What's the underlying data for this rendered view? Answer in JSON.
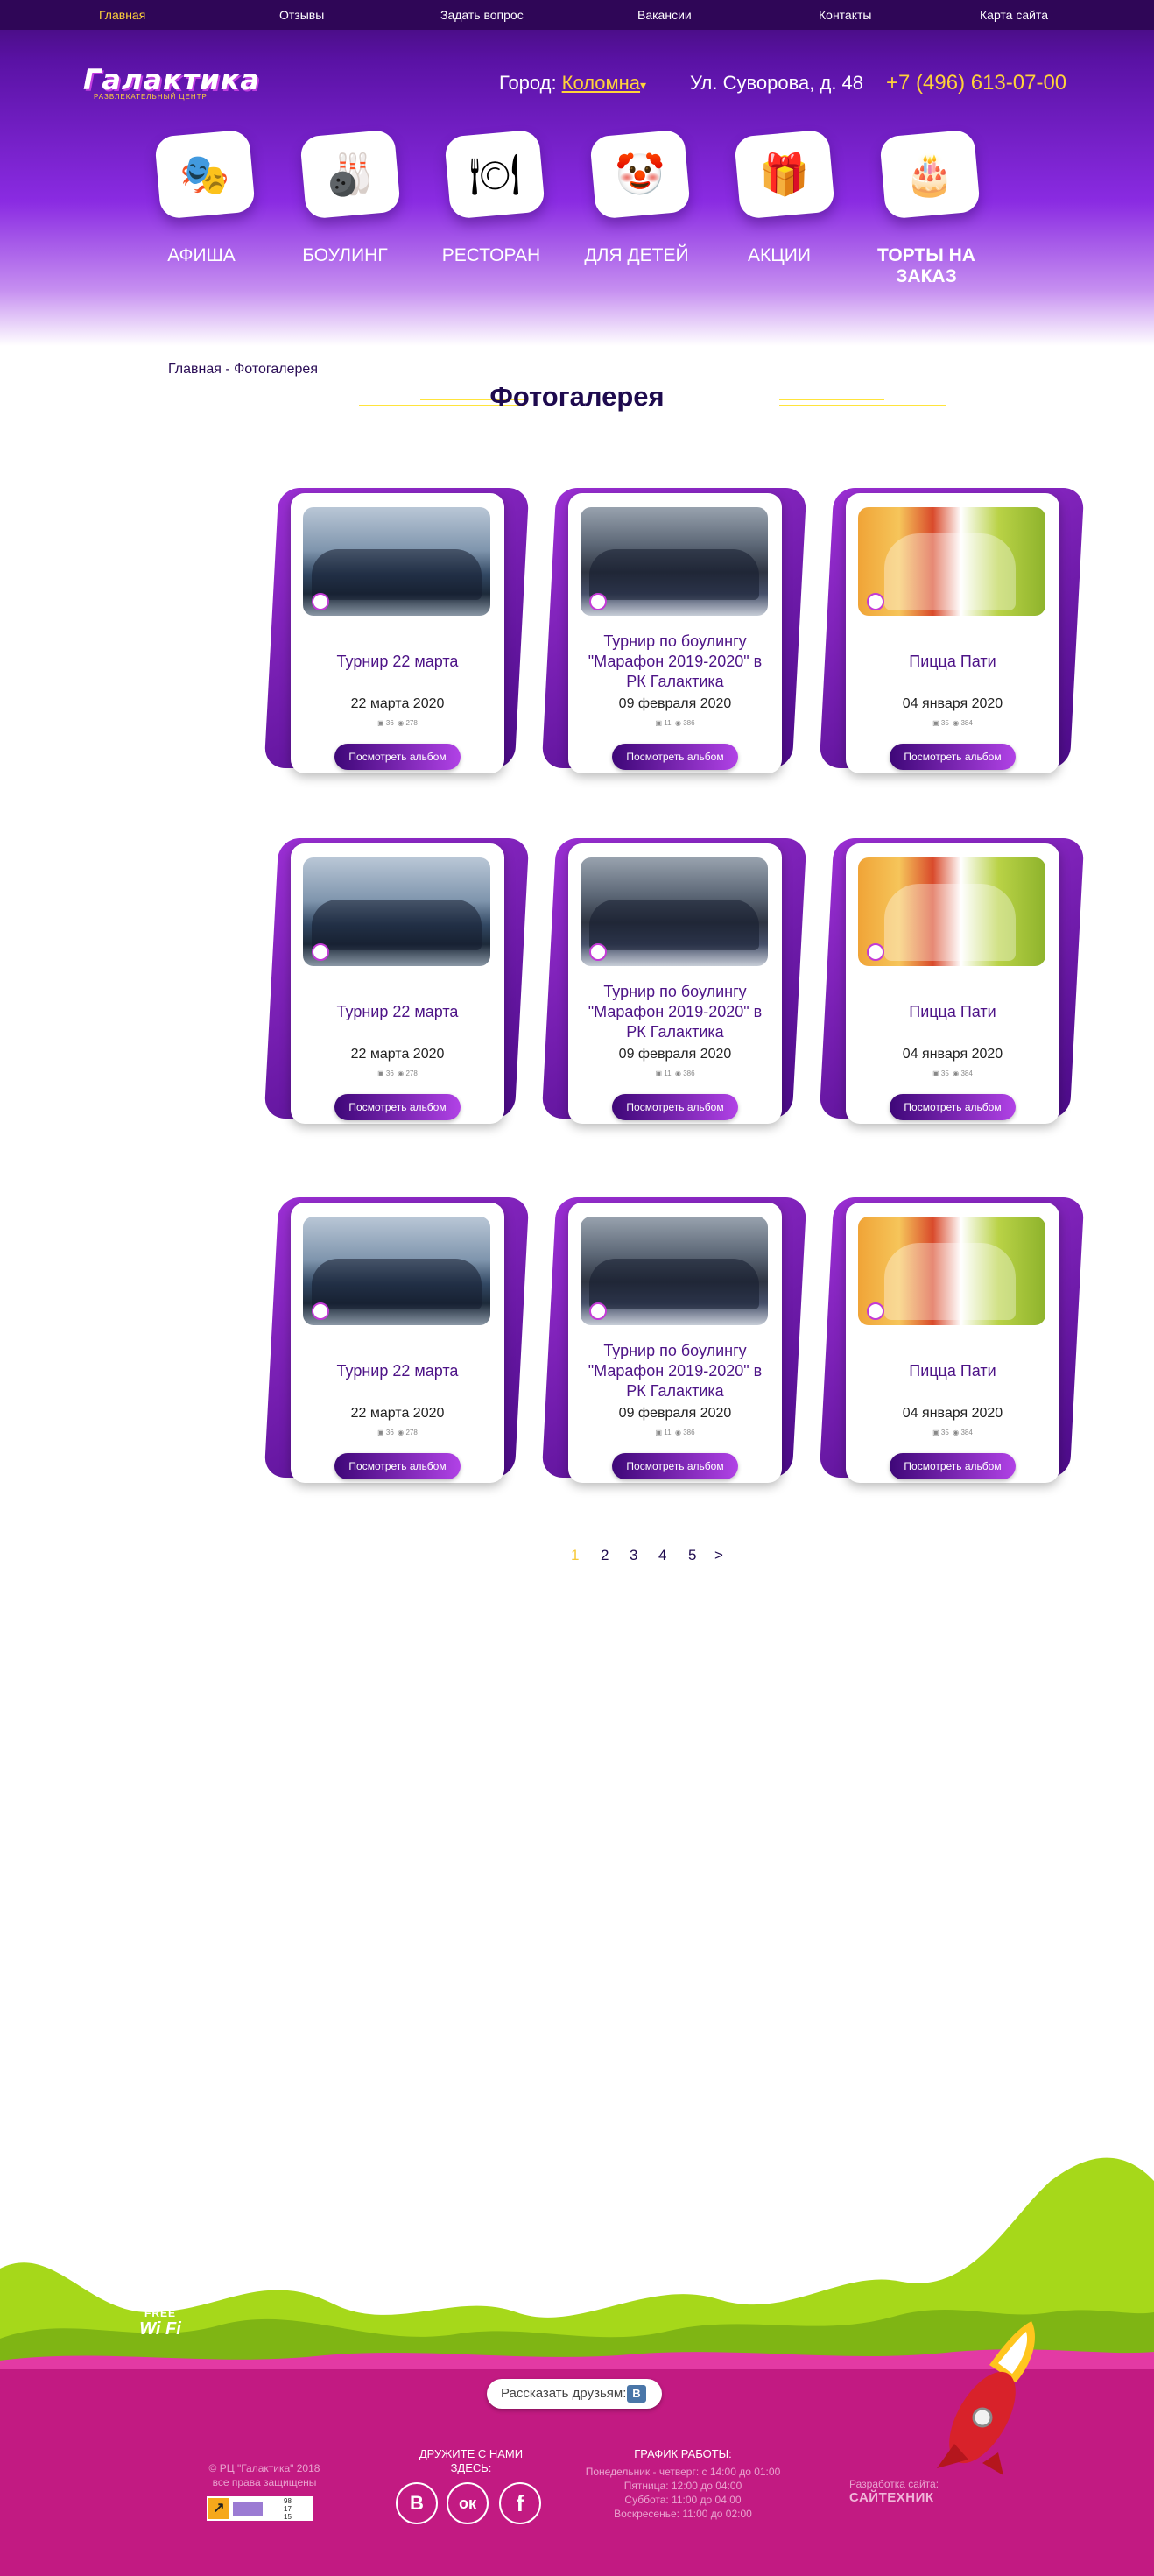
{
  "topnav": {
    "items": [
      "Главная",
      "Отзывы",
      "Задать вопрос",
      "Вакансии",
      "Контакты",
      "Карта сайта"
    ],
    "active_index": 0
  },
  "header": {
    "logo_text": "Галактика",
    "logo_subtitle": "РАЗВЛЕКАТЕЛЬНЫЙ ЦЕНТР",
    "city_label": "Город:",
    "city_value": "Коломна",
    "address": "Ул. Суворова, д. 48",
    "phone": "+7 (496) 613-07-00"
  },
  "categories": [
    {
      "label": "АФИША",
      "icon": "mask-icon",
      "glyph": "🎭"
    },
    {
      "label": "БОУЛИНГ",
      "icon": "bowling-icon",
      "glyph": "🎳"
    },
    {
      "label": "РЕСТОРАН",
      "icon": "cloche-icon",
      "glyph": "🍽"
    },
    {
      "label": "ДЛЯ ДЕТЕЙ",
      "icon": "clown-icon",
      "glyph": "🤡"
    },
    {
      "label": "АКЦИИ",
      "icon": "gift-icon",
      "glyph": "🎁"
    },
    {
      "label": "ТОРТЫ НА ЗАКАЗ",
      "icon": "cake-icon",
      "glyph": "🎂"
    }
  ],
  "breadcrumb": {
    "home": "Главная",
    "separator": "-",
    "current": "Фотогалерея"
  },
  "page_title": "Фотогалерея",
  "albums": [
    {
      "title": "Турнир 22 марта",
      "date": "22 марта 2020",
      "photos": "36",
      "views": "278",
      "button": "Посмотреть альбом",
      "photo_style": "blue"
    },
    {
      "title": "Турнир по боулингу \"Марафон 2019-2020\" в РК Галактика",
      "date": "09 февраля 2020",
      "photos": "11",
      "views": "386",
      "button": "Посмотреть альбом",
      "photo_style": "grey"
    },
    {
      "title": "Пицца Пати",
      "date": "04 января 2020",
      "photos": "35",
      "views": "384",
      "button": "Посмотреть альбом",
      "photo_style": "party"
    },
    {
      "title": "Турнир 22 марта",
      "date": "22 марта 2020",
      "photos": "36",
      "views": "278",
      "button": "Посмотреть альбом",
      "photo_style": "blue"
    },
    {
      "title": "Турнир по боулингу \"Марафон 2019-2020\" в РК Галактика",
      "date": "09 февраля 2020",
      "photos": "11",
      "views": "386",
      "button": "Посмотреть альбом",
      "photo_style": "grey"
    },
    {
      "title": "Пицца Пати",
      "date": "04 января 2020",
      "photos": "35",
      "views": "384",
      "button": "Посмотреть альбом",
      "photo_style": "party"
    },
    {
      "title": "Турнир 22 марта",
      "date": "22 марта 2020",
      "photos": "36",
      "views": "278",
      "button": "Посмотреть альбом",
      "photo_style": "blue"
    },
    {
      "title": "Турнир по боулингу \"Марафон 2019-2020\" в РК Галактика",
      "date": "09 февраля 2020",
      "photos": "11",
      "views": "386",
      "button": "Посмотреть альбом",
      "photo_style": "grey"
    },
    {
      "title": "Пицца Пати",
      "date": "04 января 2020",
      "photos": "35",
      "views": "384",
      "button": "Посмотреть альбом",
      "photo_style": "party"
    }
  ],
  "pagination": {
    "pages": [
      "1",
      "2",
      "3",
      "4",
      "5"
    ],
    "next": ">",
    "current": "1"
  },
  "footer": {
    "wifi_free": "FREE",
    "wifi_label": "Wi Fi",
    "share_label": "Рассказать друзьям:",
    "share_vk": "В",
    "copyright_lines": [
      "© РЦ \"Галактика\" 2018",
      "все права защищены"
    ],
    "counter_nums": [
      "98",
      "17",
      "15"
    ],
    "friends_label": "ДРУЖИТЕ С НАМИ ЗДЕСЬ:",
    "socials": [
      {
        "name": "vk-icon",
        "glyph": "В"
      },
      {
        "name": "odnoklassniki-icon",
        "glyph": "ок"
      },
      {
        "name": "facebook-icon",
        "glyph": "f"
      }
    ],
    "schedule_title": "ГРАФИК РАБОТЫ:",
    "schedule_lines": [
      "Понедельник - четверг: с 14:00 до 01:00",
      "Пятница: 12:00 до 04:00",
      "Суббота: 11:00 до 04:00",
      "Воскресенье: 11:00 до 02:00"
    ],
    "developer_label": "Разработка сайта:",
    "developer_name": "САЙТЕХНИК"
  },
  "colors": {
    "header_dark": "#2f0657",
    "header_purple": "#8a2be2",
    "accent_yellow": "#ffd23a",
    "card_title": "#4d1387",
    "footer_magenta": "#c21a82",
    "hill_green": "#a4d417"
  }
}
